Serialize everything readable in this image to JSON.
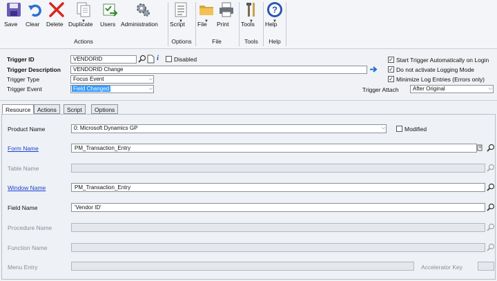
{
  "ribbon": {
    "buttons": [
      {
        "label": "Save",
        "icon": "save-icon"
      },
      {
        "label": "Clear",
        "icon": "undo-icon"
      },
      {
        "label": "Delete",
        "icon": "delete-icon"
      },
      {
        "label": "Duplicate",
        "icon": "duplicate-icon"
      },
      {
        "label": "Users",
        "icon": "users-icon"
      },
      {
        "label": "Administration",
        "icon": "gears-icon"
      },
      {
        "label": "Script",
        "icon": "script-icon"
      },
      {
        "label": "File",
        "icon": "folder-icon"
      },
      {
        "label": "Print",
        "icon": "printer-icon"
      },
      {
        "label": "Tools",
        "icon": "tools-icon"
      },
      {
        "label": "Help",
        "icon": "help-icon"
      }
    ],
    "groups": [
      "Actions",
      "Options",
      "File",
      "Tools",
      "Help"
    ]
  },
  "header": {
    "trigger_id_label": "Trigger ID",
    "trigger_id_value": "VENDORID",
    "disabled_label": "Disabled",
    "trigger_description_label": "Trigger Description",
    "trigger_description_value": "VENDORID Change",
    "trigger_type_label": "Trigger Type",
    "trigger_type_value": "Focus Event",
    "trigger_event_label": "Trigger Event",
    "trigger_event_value": "Field Changed",
    "trigger_attach_label": "Trigger Attach",
    "trigger_attach_value": "After Original",
    "options": [
      {
        "label": "Start Trigger Automatically on Login",
        "checked": "✓"
      },
      {
        "label": "Do not activate Logging Mode",
        "checked": "✓"
      },
      {
        "label": "Minimize Log Entries (Errors only)",
        "checked": "✓"
      }
    ]
  },
  "tabs": [
    "Resource",
    "Actions",
    "Script",
    "Options"
  ],
  "resource": {
    "product_name_label": "Product Name",
    "product_name_value": "0: Microsoft Dynamics GP",
    "modified_label": "Modified",
    "form_name_label": "Form Name",
    "form_name_value": "PM_Transaction_Entry",
    "table_name_label": "Table Name",
    "window_name_label": "Window Name",
    "window_name_value": "PM_Transaction_Entry",
    "field_name_label": "Field Name",
    "field_name_value": "'Vendor ID'",
    "procedure_name_label": "Procedure Name",
    "function_name_label": "Function Name",
    "menu_entry_label": "Menu Entry",
    "accelerator_key_label": "Accelerator Key"
  }
}
